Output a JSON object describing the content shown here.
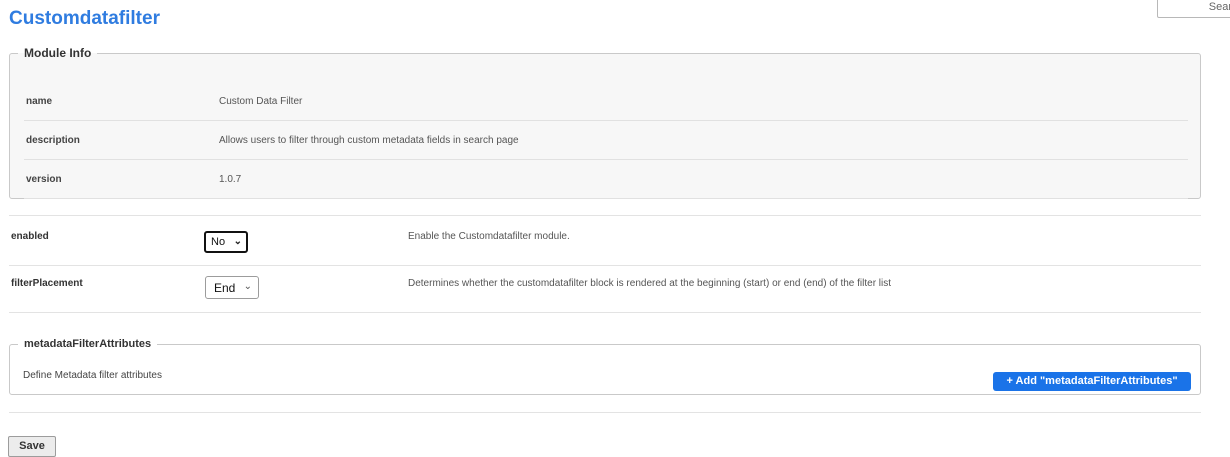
{
  "page": {
    "title": "Customdatafilter",
    "search_placeholder": "Sear"
  },
  "module_info": {
    "legend": "Module Info",
    "rows": [
      {
        "key": "name",
        "value": "Custom Data Filter"
      },
      {
        "key": "description",
        "value": "Allows users to filter through custom metadata fields in search page"
      },
      {
        "key": "version",
        "value": "1.0.7"
      }
    ]
  },
  "settings": {
    "enabled": {
      "label": "enabled",
      "selected": "No",
      "description": "Enable the Customdatafilter module."
    },
    "filterPlacement": {
      "label": "filterPlacement",
      "selected": "End",
      "description": "Determines whether the customdatafilter block is rendered at the beginning (start) or end (end) of the filter list"
    }
  },
  "metadata_filter_attributes": {
    "legend": "metadataFilterAttributes",
    "description": "Define Metadata filter attributes",
    "add_button_label": "+ Add \"metadataFilterAttributes\""
  },
  "footer": {
    "save_label": "Save"
  },
  "colors": {
    "title": "#2f7ce0",
    "add_button": "#1a73e8"
  }
}
